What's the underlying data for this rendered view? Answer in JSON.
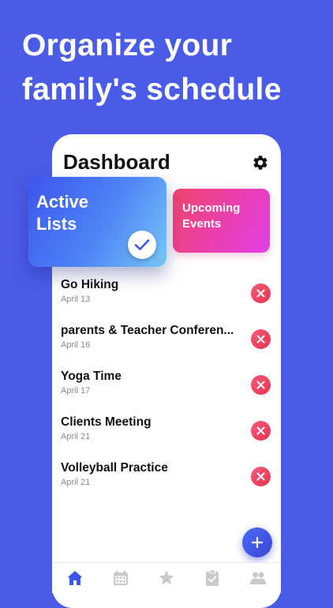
{
  "headline": {
    "line1": "Organize your",
    "line2": "family's schedule"
  },
  "dashboard": {
    "title": "Dashboard",
    "cards": {
      "active_label": "Active Lists",
      "upcoming_label": "Upcoming Events"
    },
    "items": [
      {
        "title": "Go Hiking",
        "date": "April 13"
      },
      {
        "title": "parents & Teacher Conferen...",
        "date": "April 16"
      },
      {
        "title": "Yoga Time",
        "date": "April 17"
      },
      {
        "title": "Clients Meeting",
        "date": "April 21"
      },
      {
        "title": "Volleyball Practice",
        "date": "April 21"
      }
    ]
  },
  "tabbar": {
    "tabs": [
      "home-icon",
      "calendar-icon",
      "star-icon",
      "checklist-icon",
      "family-icon"
    ],
    "active_index": 0
  },
  "colors": {
    "background": "#4a5be8",
    "accent": "#3b56ec",
    "delete": "#ec4060",
    "inactive_icon": "#c9c9c9"
  }
}
